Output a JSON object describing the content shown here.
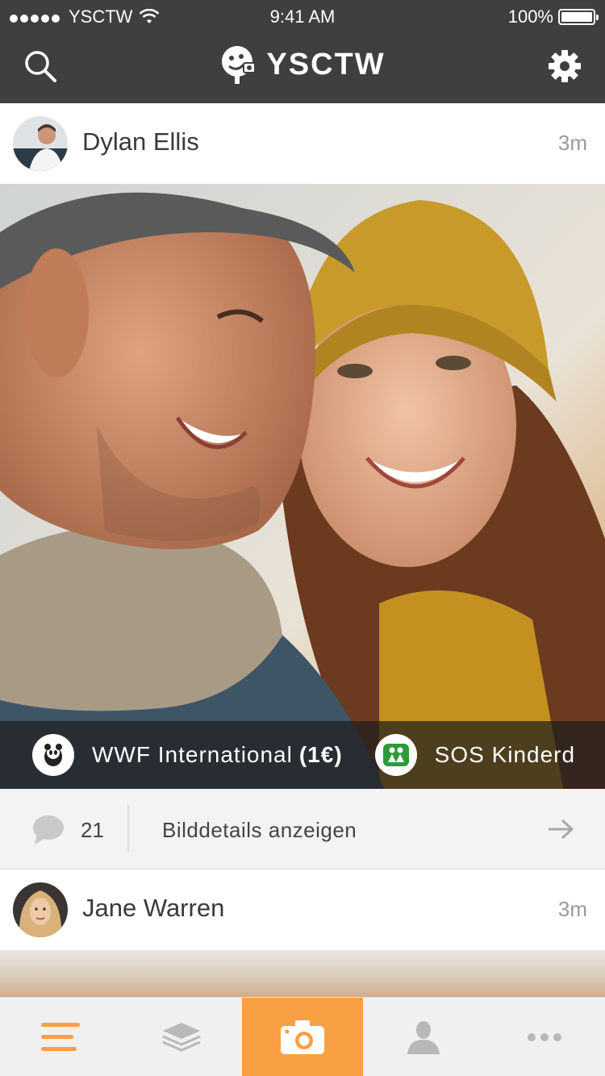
{
  "status_bar": {
    "carrier": "YSCTW",
    "time": "9:41 AM",
    "battery": "100%"
  },
  "header": {
    "app_name": "YSCTW",
    "search_icon": "search-icon",
    "settings_icon": "gear-icon"
  },
  "posts": [
    {
      "author": "Dylan Ellis",
      "time": "3m",
      "charities": [
        {
          "name": "WWF International",
          "amount": "(1€)",
          "icon": "panda-icon"
        },
        {
          "name": "SOS Kinderd",
          "amount": "",
          "icon": "children-icon"
        }
      ],
      "comment_count": "21",
      "details_link": "Bilddetails anzeigen"
    },
    {
      "author": "Jane Warren",
      "time": "3m"
    }
  ],
  "tab_bar": {
    "tabs": [
      {
        "name": "feed",
        "icon": "menu-icon",
        "active": false
      },
      {
        "name": "layers",
        "icon": "layers-icon",
        "active": false
      },
      {
        "name": "camera",
        "icon": "camera-icon",
        "active": true
      },
      {
        "name": "profile",
        "icon": "user-icon",
        "active": false
      },
      {
        "name": "more",
        "icon": "more-icon",
        "active": false
      }
    ]
  },
  "colors": {
    "header_bg": "#3f3f3f",
    "accent": "#f9a044"
  }
}
